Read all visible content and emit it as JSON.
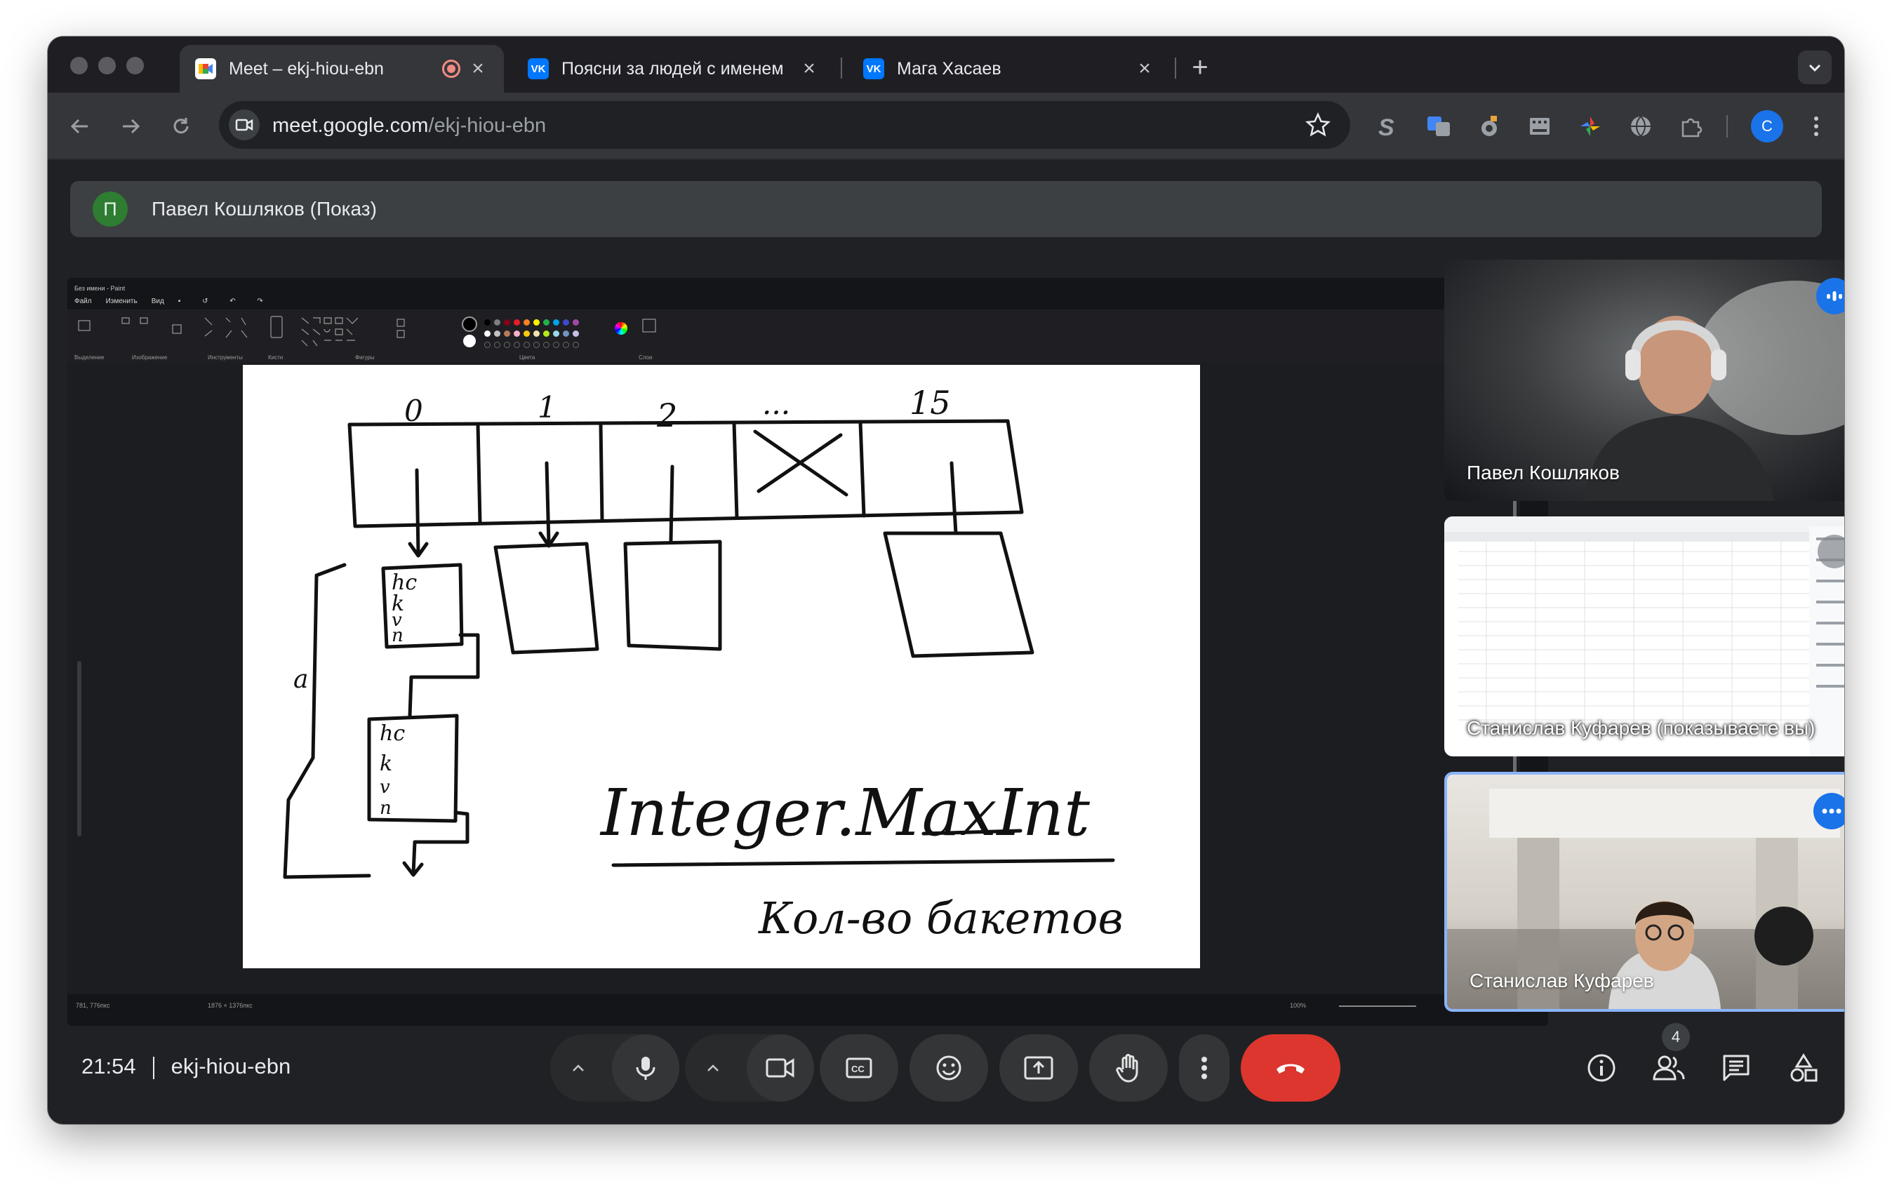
{
  "browser": {
    "tabs": [
      {
        "title": "Meet – ekj-hiou-ebn",
        "favicon": "google-meet-icon",
        "recording": true,
        "active": true
      },
      {
        "title": "Поясни за людей с именем",
        "favicon": "vk-icon",
        "active": false
      },
      {
        "title": "Мага Хасаев",
        "favicon": "vk-icon",
        "active": false
      }
    ],
    "favicon_vk_text": "VK",
    "url_host": "meet.google.com",
    "url_path": "/ekj-hiou-ebn",
    "profile_initial": "C",
    "extensions": [
      "s-extension-icon",
      "translate-extension-icon",
      "camera-extension-icon",
      "film-extension-icon",
      "color-extension-icon",
      "globe-extension-icon",
      "puzzle-extensions-icon"
    ]
  },
  "meeting": {
    "presenter_initial": "П",
    "presenter_label": "Павел Кошляков (Показ)",
    "time": "21:54",
    "meeting_code": "ekj-hiou-ebn",
    "participant_count": "4"
  },
  "paint": {
    "title": "Без имени - Paint",
    "menu": [
      "Файл",
      "Изменить",
      "Вид"
    ],
    "ribbon_groups": [
      "Выделение",
      "Изображение",
      "Инструменты",
      "Кисти",
      "Фигуры",
      "Цвета",
      "Слои"
    ],
    "status_position": "781, 776пкс",
    "status_size": "1876 × 1376пкс",
    "zoom": "100%",
    "palette": [
      "#000000",
      "#7f7f7f",
      "#880015",
      "#ed1c24",
      "#ff7f27",
      "#fff200",
      "#22b14c",
      "#00a2e8",
      "#3f48cc",
      "#a349a4",
      "#ffffff",
      "#c3c3c3",
      "#b97a57",
      "#ffaec9",
      "#ffc90e",
      "#efe4b0",
      "#b5e61d",
      "#99d9ea",
      "#7092be",
      "#c8bfe7"
    ]
  },
  "drawing": {
    "indices": [
      "0",
      "1",
      "2",
      "...",
      "15"
    ],
    "node_lines": [
      "hc",
      "k",
      "v",
      "n"
    ],
    "label_a": "a",
    "text_main": "Integer.MaxInt",
    "text_sub": "Кол-во бакетов"
  },
  "participants": [
    {
      "name": "Павел Кошляков",
      "badge": "speaking-icon",
      "kind": "camera"
    },
    {
      "name": "Станислав Куфарев (показываете вы)",
      "badge": "",
      "kind": "screen"
    },
    {
      "name": "Станислав Куфарев",
      "badge": "more-options-icon",
      "kind": "camera",
      "highlighted": true
    }
  ],
  "colors": {
    "window_bg": "#202124",
    "end_call": "#dc362e",
    "accent_blue": "#1a73e8",
    "highlight_border": "#8ab4f8"
  }
}
